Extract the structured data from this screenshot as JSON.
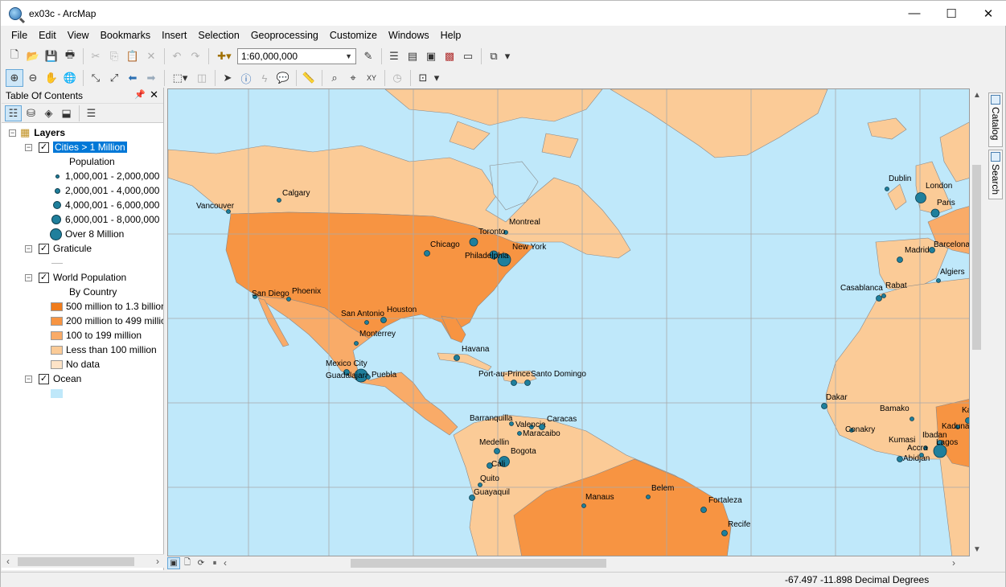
{
  "window": {
    "title": "ex03c - ArcMap",
    "minimize": "—",
    "maximize": "☐",
    "close": "✕"
  },
  "menu": [
    "File",
    "Edit",
    "View",
    "Bookmarks",
    "Insert",
    "Selection",
    "Geoprocessing",
    "Customize",
    "Windows",
    "Help"
  ],
  "toolbar": {
    "scale": "1:60,000,000"
  },
  "toc": {
    "title": "Table Of Contents",
    "root": "Layers",
    "layers": [
      {
        "name": "Cities > 1 Million",
        "checked": true,
        "selected": true,
        "field": "Population",
        "classes": [
          "1,000,001 - 2,000,000",
          "2,000,001 - 4,000,000",
          "4,000,001 - 6,000,000",
          "6,000,001 - 8,000,000",
          "Over 8 Million"
        ]
      },
      {
        "name": "Graticule",
        "checked": true
      },
      {
        "name": "World Population",
        "checked": true,
        "field": "By Country",
        "classes": [
          "500 million to 1.3 billion",
          "200 million to 499 million",
          "100 to 199 million",
          "Less than 100 million",
          "No data"
        ]
      },
      {
        "name": "Ocean",
        "checked": true
      }
    ]
  },
  "colors": {
    "ocean": "#bfe8fa",
    "land_low": "#fbcb97",
    "land_high": "#f79442",
    "land_mid": "#f9ab68",
    "city": "#1f7f9c"
  },
  "side_tabs": [
    "Catalog",
    "Search"
  ],
  "map": {
    "cities": [
      {
        "name": "Vancouver",
        "size": 1
      },
      {
        "name": "Calgary",
        "size": 1
      },
      {
        "name": "Montreal",
        "size": 1
      },
      {
        "name": "Toronto",
        "size": 3
      },
      {
        "name": "Chicago",
        "size": 2
      },
      {
        "name": "New York",
        "size": 5
      },
      {
        "name": "Philadelphia",
        "size": 3
      },
      {
        "name": "San Diego",
        "size": 1
      },
      {
        "name": "Phoenix",
        "size": 1
      },
      {
        "name": "San Antonio",
        "size": 1
      },
      {
        "name": "Houston",
        "size": 2
      },
      {
        "name": "Monterrey",
        "size": 1
      },
      {
        "name": "Havana",
        "size": 2
      },
      {
        "name": "Mexico City",
        "size": 5
      },
      {
        "name": "Guadalajara",
        "size": 2
      },
      {
        "name": "Puebla",
        "size": 1
      },
      {
        "name": "Port-au-Prince",
        "size": 2
      },
      {
        "name": "Santo Domingo",
        "size": 2
      },
      {
        "name": "Barranquilla",
        "size": 1
      },
      {
        "name": "Valencia",
        "size": 1
      },
      {
        "name": "Caracas",
        "size": 2
      },
      {
        "name": "Maracaibo",
        "size": 1
      },
      {
        "name": "Medellin",
        "size": 2
      },
      {
        "name": "Bogota",
        "size": 4
      },
      {
        "name": "Cali",
        "size": 2
      },
      {
        "name": "Quito",
        "size": 1
      },
      {
        "name": "Guayaquil",
        "size": 2
      },
      {
        "name": "Manaus",
        "size": 1
      },
      {
        "name": "Belem",
        "size": 1
      },
      {
        "name": "Fortaleza",
        "size": 2
      },
      {
        "name": "Recife",
        "size": 2
      },
      {
        "name": "Dublin",
        "size": 1
      },
      {
        "name": "London",
        "size": 4
      },
      {
        "name": "Paris",
        "size": 3
      },
      {
        "name": "Madrid",
        "size": 2
      },
      {
        "name": "Barcelona",
        "size": 2
      },
      {
        "name": "Algiers",
        "size": 1
      },
      {
        "name": "Casablanca",
        "size": 2
      },
      {
        "name": "Rabat",
        "size": 1
      },
      {
        "name": "Dakar",
        "size": 2
      },
      {
        "name": "Bamako",
        "size": 1
      },
      {
        "name": "Kano",
        "size": 2
      },
      {
        "name": "Kaduna",
        "size": 1
      },
      {
        "name": "Conakry",
        "size": 1
      },
      {
        "name": "Kumasi",
        "size": 1
      },
      {
        "name": "Abidjan",
        "size": 2
      },
      {
        "name": "Ibadan",
        "size": 2
      },
      {
        "name": "Lagos",
        "size": 5
      },
      {
        "name": "Accra",
        "size": 1
      }
    ]
  },
  "status": {
    "coords": "-67.497  -11.898 Decimal Degrees"
  }
}
